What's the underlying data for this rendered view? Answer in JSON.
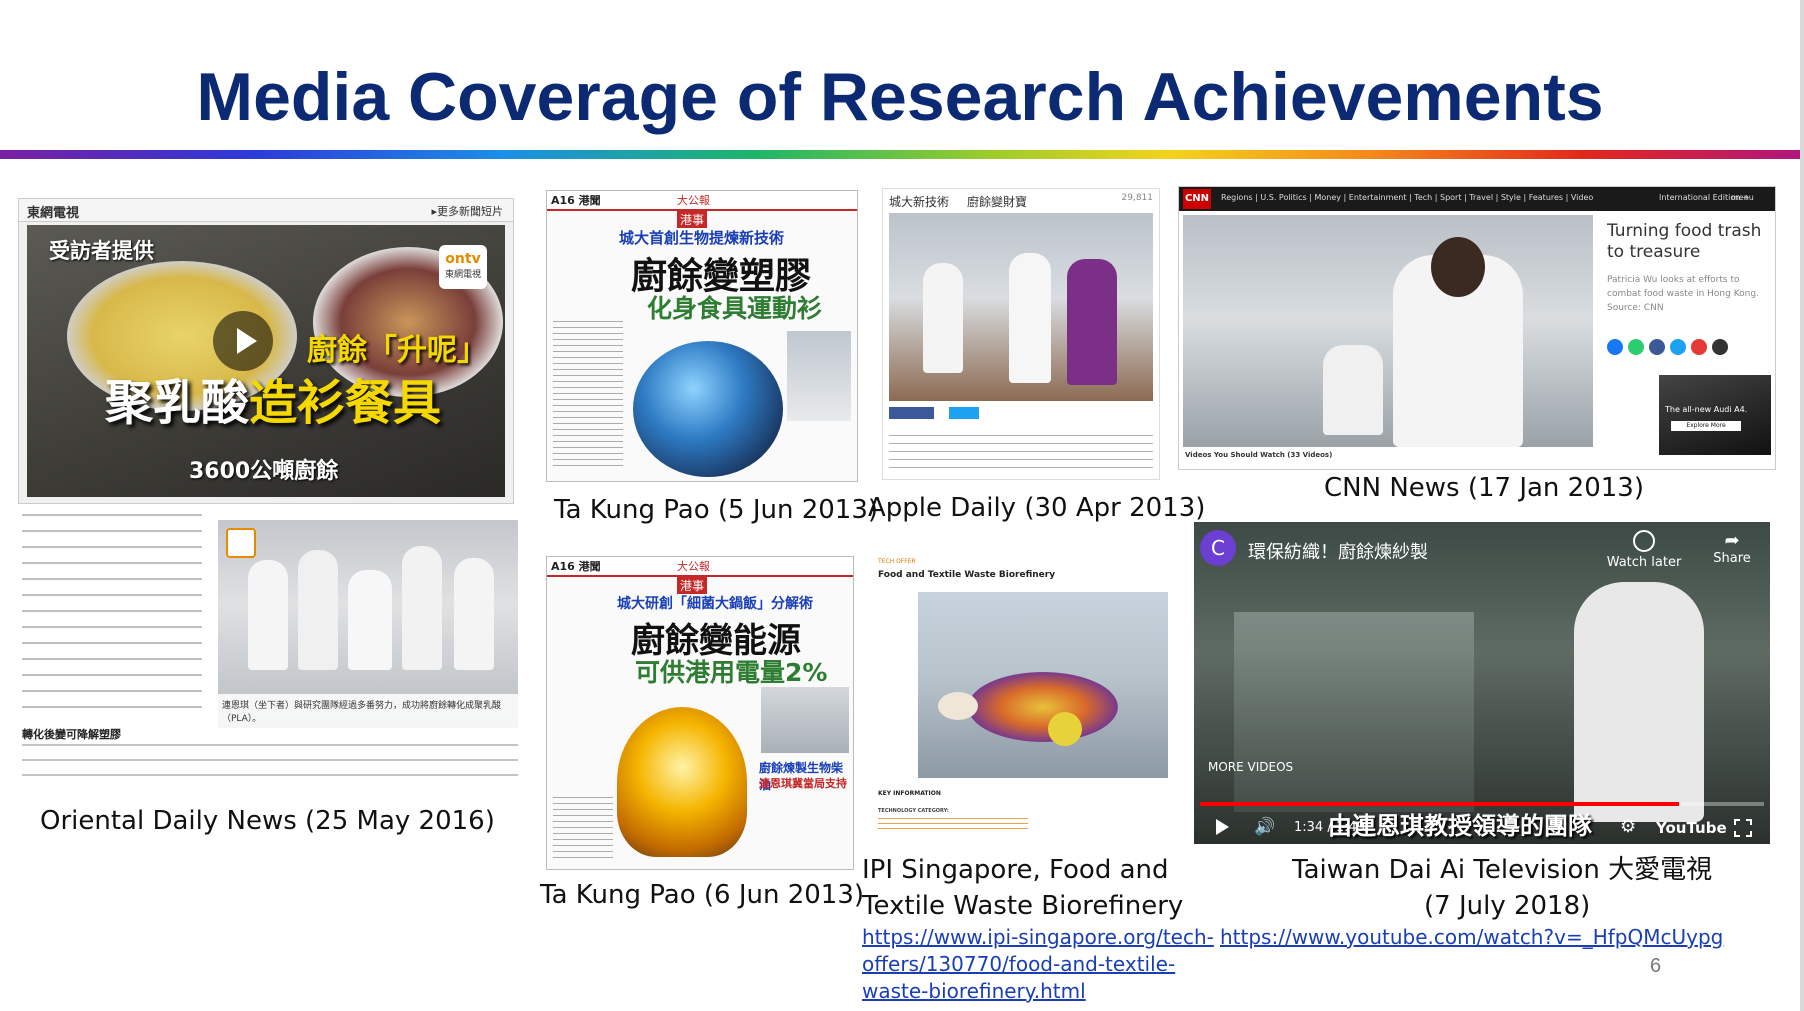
{
  "slide": {
    "title": "Media Coverage of Research Achievements",
    "page_number": "6"
  },
  "items": {
    "oriental": {
      "caption": "Oriental Daily News (25 May 2016)",
      "channel": "東網電視",
      "more_link": "▸更多新聞短片",
      "provided": "受訪者提供",
      "headline1": "廚餘「升呢」",
      "headline2a": "聚乳酸",
      "headline2b": "造衫餐具",
      "subline": "3600公噸廚餘",
      "logo_text": "ontv",
      "logo_sub": "東網電視",
      "photo_caption": "連恩琪（坐下者）與研究團隊經過多番努力，成功將廚餘轉化成聚乳酸（PLA）。",
      "section_head": "轉化後變可降解塑膠"
    },
    "takungpao1": {
      "caption": "Ta Kung Pao (5 Jun 2013)",
      "page_tag": "A16 港聞",
      "section_tag": "港事",
      "masthead": "大公報",
      "kicker": "城大首創生物提煉新技術",
      "headline": "廚餘變塑膠",
      "subhead": "化身食具運動衫"
    },
    "takungpao2": {
      "caption": "Ta Kung Pao (6 Jun 2013)",
      "page_tag": "A16 港聞",
      "section_tag": "港事",
      "masthead": "大公報",
      "kicker": "城大研創「細菌大鍋飯」分解術",
      "headline": "廚餘變能源",
      "subhead": "可供港用電量2%",
      "sidebar": "廚餘煉製生物柴油",
      "sidebar2": "連恩琪冀當局支持"
    },
    "apple": {
      "caption": "Apple Daily (30 Apr 2013)",
      "tag1": "城大新技術",
      "tag2": "廚餘變財寶",
      "views": "29,811"
    },
    "cnn": {
      "caption": "CNN News (17 Jan 2013)",
      "logo": "CNN",
      "nav": "Regions | U.S. Politics | Money | Entertainment | Tech | Sport | Travel | Style | Features | Video",
      "edition": "International Edition +",
      "menu": "menu",
      "headline": "Turning food trash to treasure",
      "summary": "Patricia Wu looks at efforts to combat food waste in Hong Kong. Source: CNN",
      "ad_text": "The all-new Audi A4.",
      "ad_button": "Explore More",
      "footer": "Videos You Should Watch (33 Videos)"
    },
    "ipi": {
      "caption_line1": "IPI Singapore, Food and",
      "caption_line2": "Textile Waste Biorefinery",
      "link_line1": "https://www.ipi-singapore.org/tech-",
      "link_line2": "offers/130770/food-and-textile-",
      "link_line3": "waste-biorefinery.html",
      "tag": "TECH OFFER",
      "doc_title": "Food and Textile Waste Biorefinery",
      "key_info": "KEY INFORMATION",
      "tech_cat": "TECHNOLOGY CATEGORY:"
    },
    "taiwan": {
      "caption_line1": "Taiwan Dai Ai Television 大愛電視",
      "caption_line2": "(7 July 2018)",
      "link": "https://www.youtube.com/watch?v=_HfpQMcUypg",
      "channel_initial": "C",
      "video_title": "環保紡織！廚餘煉紗製",
      "watch_later": "Watch later",
      "share": "Share",
      "more_videos": "MORE VIDEOS",
      "time": "1:34 / 1:49",
      "subtitle": "由連恩琪教授領導的團隊",
      "youtube": "YouTube",
      "progress": 0.85
    }
  },
  "colors": {
    "title": "#0b2a73",
    "link": "#1a3fb5",
    "cnn_red": "#cc0000",
    "youtube_red": "#ff0000"
  }
}
